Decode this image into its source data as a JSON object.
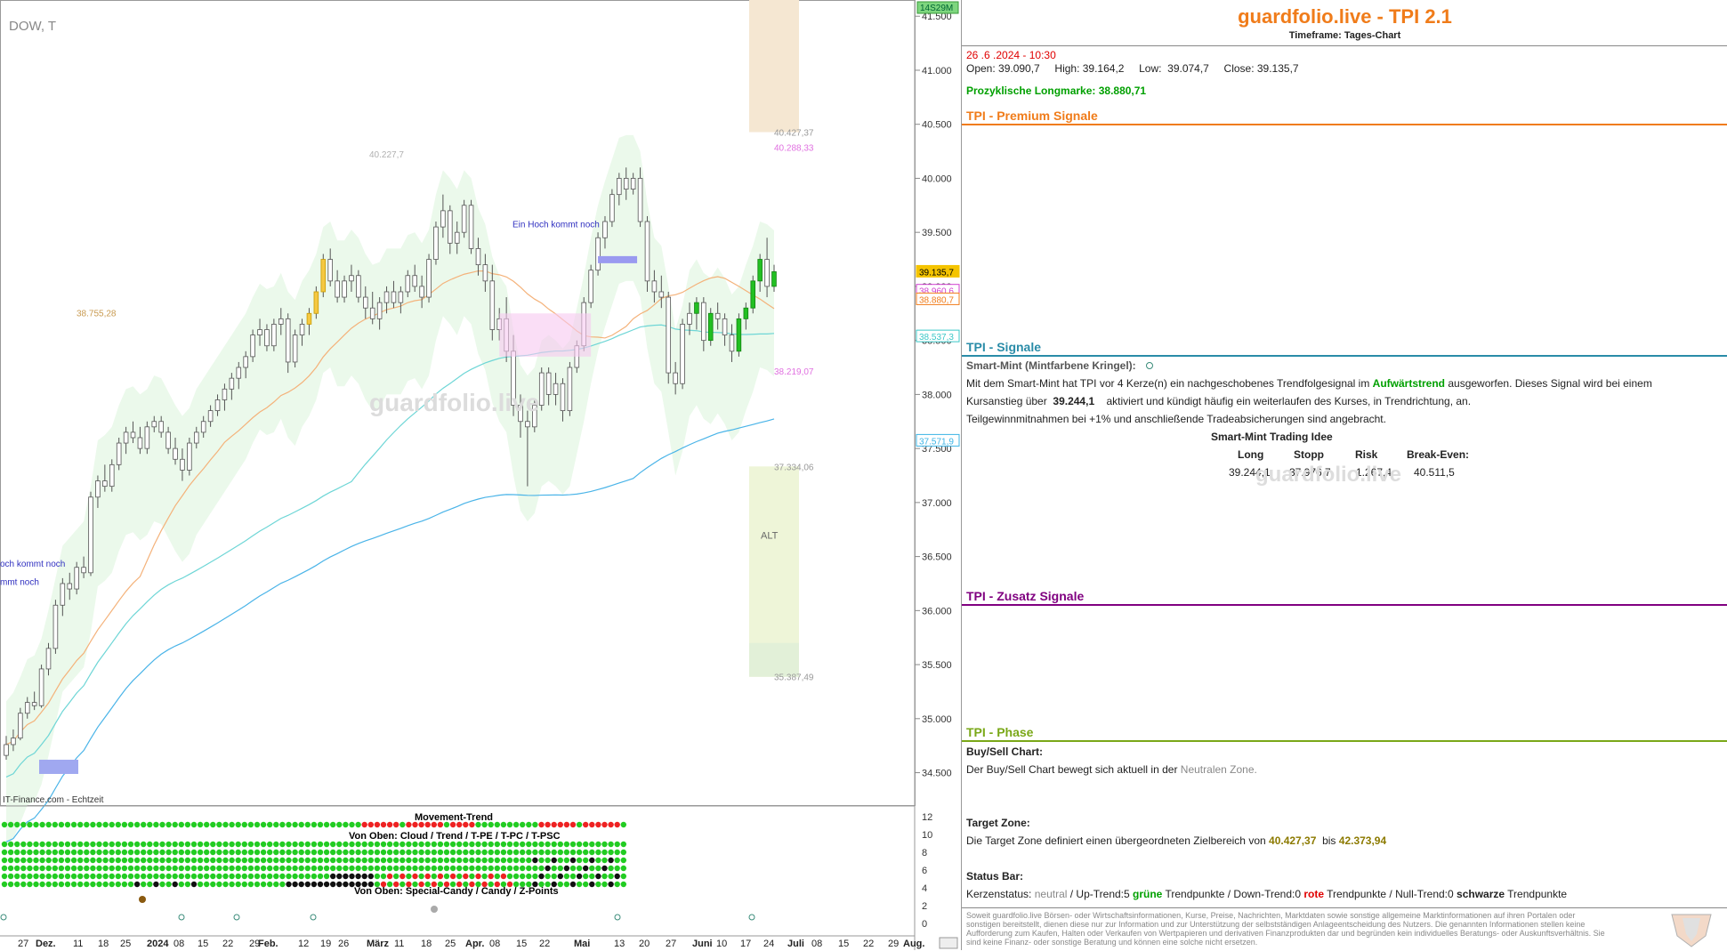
{
  "chart_data": {
    "type": "candlestick",
    "symbol": "DOW, T",
    "source_label": "IT-Finance.com - Echtzeit",
    "watermark": "guardfolio.live",
    "yticks": [
      "41.500",
      "41.000",
      "40.500",
      "40.000",
      "39.500",
      "39.000",
      "38.500",
      "38.000",
      "37.500",
      "37.000",
      "36.500",
      "36.000",
      "35.500",
      "35.000",
      "34.500"
    ],
    "ytick_values": [
      41500,
      41000,
      40500,
      40000,
      39500,
      39000,
      38500,
      38000,
      37500,
      37000,
      36500,
      36000,
      35500,
      35000,
      34500
    ],
    "ylim": [
      34200,
      41650
    ],
    "xticks": [
      "27",
      "Dez.",
      "11",
      "18",
      "25",
      "2024",
      "08",
      "15",
      "22",
      "29",
      "Feb.",
      "12",
      "19",
      "26",
      "März",
      "11",
      "18",
      "25",
      "Apr.",
      "08",
      "15",
      "22",
      "Mai",
      "13",
      "20",
      "27",
      "Juni",
      "10",
      "17",
      "24",
      "Juli",
      "08",
      "15",
      "22",
      "29",
      "Aug."
    ],
    "time_badge": "14S29M",
    "price_markers": [
      {
        "label": "39.135,7",
        "value": 39135.7,
        "color": "#f5c400"
      },
      {
        "label": "38.960,6",
        "value": 38960.6,
        "color": "#d040d0"
      },
      {
        "label": "38.880,7",
        "value": 38880.7,
        "color": "#f07c1a"
      },
      {
        "label": "38.537,3",
        "value": 38537.3,
        "color": "#3cc8c8"
      },
      {
        "label": "37.571,9",
        "value": 37571.9,
        "color": "#3cb4e6"
      }
    ],
    "annotations": [
      {
        "text": "40.227,7",
        "value": 40227.7,
        "color": "#b0b0b0"
      },
      {
        "text": "38.755,28",
        "value": 38755.28,
        "color": "#c89a50"
      },
      {
        "text": "40.427,37",
        "value": 40427.37,
        "color": "#999999"
      },
      {
        "text": "40.288,33",
        "value": 40288.33,
        "color": "#e070e0"
      },
      {
        "text": "38.219,07",
        "value": 38219.07,
        "color": "#e070e0"
      },
      {
        "text": "37.334,06",
        "value": 37334.06,
        "color": "#999999"
      },
      {
        "text": "35.387,49",
        "value": 35387.49,
        "color": "#999999"
      },
      {
        "text": "ALT",
        "value": 36700,
        "color": "#666666"
      },
      {
        "text": "Ein Hoch kommt noch",
        "value": 39580,
        "color": "#3030c0"
      },
      {
        "text": "och kommt noch",
        "value": 36440,
        "color": "#3030c0"
      },
      {
        "text": "mmt noch",
        "value": 36270,
        "color": "#3030c0"
      }
    ],
    "candles_ohlc_approx": [
      [
        34660,
        34840,
        34620,
        34760
      ],
      [
        34760,
        34900,
        34700,
        34820
      ],
      [
        34820,
        35100,
        34800,
        35050
      ],
      [
        35050,
        35200,
        35000,
        35150
      ],
      [
        35150,
        35250,
        35080,
        35120
      ],
      [
        35120,
        35500,
        35100,
        35460
      ],
      [
        35460,
        35700,
        35400,
        35650
      ],
      [
        35650,
        36100,
        35600,
        36050
      ],
      [
        36050,
        36300,
        35950,
        36250
      ],
      [
        36250,
        36350,
        36100,
        36200
      ],
      [
        36200,
        36450,
        36150,
        36400
      ],
      [
        36400,
        36500,
        36300,
        36350
      ],
      [
        36350,
        37100,
        36320,
        37050
      ],
      [
        37050,
        37250,
        36950,
        37200
      ],
      [
        37200,
        37350,
        37100,
        37150
      ],
      [
        37150,
        37400,
        37100,
        37350
      ],
      [
        37350,
        37600,
        37300,
        37550
      ],
      [
        37550,
        37700,
        37450,
        37650
      ],
      [
        37650,
        37750,
        37550,
        37600
      ],
      [
        37600,
        37700,
        37450,
        37500
      ],
      [
        37500,
        37750,
        37450,
        37700
      ],
      [
        37700,
        37800,
        37650,
        37750
      ],
      [
        37750,
        37800,
        37600,
        37650
      ],
      [
        37650,
        37700,
        37450,
        37500
      ],
      [
        37500,
        37600,
        37350,
        37400
      ],
      [
        37400,
        37500,
        37200,
        37300
      ],
      [
        37300,
        37600,
        37250,
        37550
      ],
      [
        37550,
        37700,
        37500,
        37650
      ],
      [
        37650,
        37800,
        37600,
        37750
      ],
      [
        37750,
        37900,
        37700,
        37850
      ],
      [
        37850,
        38000,
        37800,
        37950
      ],
      [
        37950,
        38100,
        37850,
        38050
      ],
      [
        38050,
        38200,
        37950,
        38150
      ],
      [
        38150,
        38300,
        38050,
        38250
      ],
      [
        38250,
        38400,
        38150,
        38350
      ],
      [
        38350,
        38600,
        38300,
        38550
      ],
      [
        38550,
        38700,
        38450,
        38600
      ],
      [
        38600,
        38650,
        38400,
        38450
      ],
      [
        38450,
        38700,
        38400,
        38650
      ],
      [
        38650,
        38800,
        38550,
        38700
      ],
      [
        38700,
        38750,
        38200,
        38300
      ],
      [
        38300,
        38600,
        38250,
        38550
      ],
      [
        38550,
        38700,
        38450,
        38650
      ],
      [
        38650,
        38800,
        38550,
        38750
      ],
      [
        38750,
        39000,
        38700,
        38950
      ],
      [
        38950,
        39300,
        38900,
        39250
      ],
      [
        39250,
        39350,
        39000,
        39050
      ],
      [
        39050,
        39150,
        38850,
        38900
      ],
      [
        38900,
        39100,
        38850,
        39050
      ],
      [
        39050,
        39200,
        38950,
        39100
      ],
      [
        39100,
        39150,
        38850,
        38900
      ],
      [
        38900,
        39000,
        38700,
        38800
      ],
      [
        38800,
        38950,
        38650,
        38700
      ],
      [
        38700,
        38900,
        38600,
        38850
      ],
      [
        38850,
        39000,
        38750,
        38950
      ],
      [
        38950,
        39050,
        38800,
        38850
      ],
      [
        38850,
        39000,
        38750,
        38950
      ],
      [
        38950,
        39150,
        38900,
        39100
      ],
      [
        39100,
        39200,
        38950,
        39000
      ],
      [
        39000,
        39100,
        38800,
        38900
      ],
      [
        38900,
        39300,
        38850,
        39250
      ],
      [
        39250,
        39600,
        39200,
        39550
      ],
      [
        39550,
        39850,
        39450,
        39700
      ],
      [
        39700,
        39750,
        39300,
        39400
      ],
      [
        39400,
        39600,
        39300,
        39500
      ],
      [
        39500,
        39800,
        39450,
        39750
      ],
      [
        39750,
        39800,
        39300,
        39350
      ],
      [
        39350,
        39450,
        39100,
        39200
      ],
      [
        39200,
        39300,
        38950,
        39050
      ],
      [
        39050,
        39200,
        38500,
        38600
      ],
      [
        38600,
        38800,
        38500,
        38700
      ],
      [
        38700,
        38900,
        38300,
        38400
      ],
      [
        38400,
        38550,
        37800,
        37900
      ],
      [
        37900,
        38000,
        37600,
        37750
      ],
      [
        37750,
        37850,
        37150,
        37700
      ],
      [
        37700,
        37950,
        37650,
        37900
      ],
      [
        37900,
        38250,
        37850,
        38200
      ],
      [
        38200,
        38250,
        37900,
        38000
      ],
      [
        38000,
        38200,
        37900,
        38100
      ],
      [
        38100,
        38150,
        37750,
        37850
      ],
      [
        37850,
        38300,
        37800,
        38250
      ],
      [
        38250,
        38500,
        38200,
        38450
      ],
      [
        38450,
        38900,
        38400,
        38850
      ],
      [
        38850,
        39200,
        38800,
        39150
      ],
      [
        39150,
        39500,
        39100,
        39450
      ],
      [
        39450,
        39650,
        39350,
        39600
      ],
      [
        39600,
        39900,
        39550,
        39850
      ],
      [
        39850,
        40050,
        39750,
        40000
      ],
      [
        40000,
        40100,
        39800,
        39900
      ],
      [
        39900,
        40050,
        39850,
        40000
      ],
      [
        40000,
        40100,
        39550,
        39600
      ],
      [
        39600,
        39650,
        38950,
        39050
      ],
      [
        39050,
        39150,
        38850,
        38950
      ],
      [
        38950,
        39100,
        38800,
        38900
      ],
      [
        38900,
        38950,
        38100,
        38200
      ],
      [
        38200,
        38300,
        38000,
        38100
      ],
      [
        38100,
        38700,
        38050,
        38650
      ],
      [
        38650,
        38850,
        38550,
        38750
      ],
      [
        38750,
        38900,
        38600,
        38850
      ],
      [
        38850,
        38900,
        38400,
        38500
      ],
      [
        38500,
        38800,
        38450,
        38750
      ],
      [
        38750,
        38850,
        38600,
        38700
      ],
      [
        38700,
        38750,
        38450,
        38550
      ],
      [
        38550,
        38650,
        38300,
        38400
      ],
      [
        38400,
        38750,
        38350,
        38700
      ],
      [
        38700,
        38850,
        38600,
        38800
      ],
      [
        38800,
        39100,
        38750,
        39050
      ],
      [
        39050,
        39300,
        38950,
        39250
      ],
      [
        39250,
        39450,
        38900,
        39000
      ],
      [
        39000,
        39200,
        38950,
        39135.7
      ]
    ]
  },
  "movement_trend": {
    "title": "Movement-Trend",
    "label_row2": "Von Oben: Cloud / Trend / T-PE / T-PC / T-PSC",
    "label_row3": "Von Oben: Special-Candy / Candy / Z-Points",
    "yticks": [
      "12",
      "10",
      "8",
      "6",
      "4",
      "2",
      "0"
    ]
  },
  "info": {
    "title": "guardfolio.live - TPI 2.1",
    "timeframe": "Timeframe: Tages-Chart",
    "datetime": "26 .6 .2024  - 10:30",
    "ohlc": "Open: 39.090,7     High: 39.164,2     Low:  39.074,7     Close: 39.135,7",
    "longmarke": "Prozyklische Longmarke: 38.880,71",
    "premium_header": "TPI - Premium Signale",
    "signale_header": "TPI - Signale",
    "smart_mint_label": "Smart-Mint (Mintfarbene Kringel):",
    "line1_a": "Mit dem Smart-Mint hat TPI vor 4  Kerze(n) ein nachgeschobenes Trendfolgesignal im",
    "line1_trend": "Aufwärtstrend",
    "line1_b": "ausgeworfen. Dieses Signal wird bei einem",
    "line2_a": "Kursanstieg über",
    "line2_val": "39.244,1",
    "line2_b": "aktiviert und kündigt häufig ein weiterlaufen des Kurses, in Trendrichtung, an.",
    "line3": "Teilgewinnmitnahmen bei +1% und anschließende Tradeabsicherungen sind angebracht.",
    "idea_title": "Smart-Mint Trading Idee",
    "idea_headers": [
      "Long",
      "Stopp",
      "Risk",
      "Break-Even:"
    ],
    "idea_values": [
      "39.244,1",
      "37.976,7",
      "1.267,4",
      "40.511,5"
    ],
    "zusatz_header": "TPI - Zusatz Signale",
    "phase_header": "TPI - Phase",
    "buysell_label": "Buy/Sell Chart:",
    "buysell_a": "Der Buy/Sell Chart bewegt sich aktuell in der",
    "buysell_zone": "Neutralen Zone.",
    "target_label": "Target Zone:",
    "target_a": "Die Target Zone definiert einen übergeordneten Zielbereich von",
    "target_v1": "40.427,37",
    "target_bis": "bis",
    "target_v2": "42.373,94",
    "status_label": "Status Bar:",
    "status_a": "Kerzenstatus:",
    "status_neutral": "neutral",
    "status_b": " / Up-Trend:5",
    "status_green": "grüne",
    "status_c": "Trendpunkte  / Down-Trend:0",
    "status_red": "rote",
    "status_d": "Trendpunkte / Null-Trend:0",
    "status_black": "schwarze",
    "status_e": "Trendpunkte",
    "disclaimer": "Soweit guardfolio.live Börsen- oder Wirtschaftsinformationen, Kurse, Preise, Nachrichten, Marktdaten sowie sonstige allgemeine Marktinformationen auf ihren Portalen oder sonstigen bereitstellt, dienen diese nur zur Information und zur Unterstützung der selbstständigen Anlageentscheidung des Nutzers. Die genannten Informationen stellen keine Aufforderung zum Kaufen, Halten oder Verkaufen von Wertpapieren und derivativen Finanzprodukten dar und begründen kein individuelles Beratungs- oder Auskunftsverhältnis. Sie sind keine Finanz- oder sonstige Beratung und können eine solche nicht ersetzen.",
    "watermark2": "guardfolio.live"
  },
  "colors": {
    "accent": "#f07c1a",
    "green": "#00b000",
    "red": "#e00000",
    "purple": "#800080",
    "teal": "#2a8ca8",
    "olive": "#8c8c00"
  }
}
